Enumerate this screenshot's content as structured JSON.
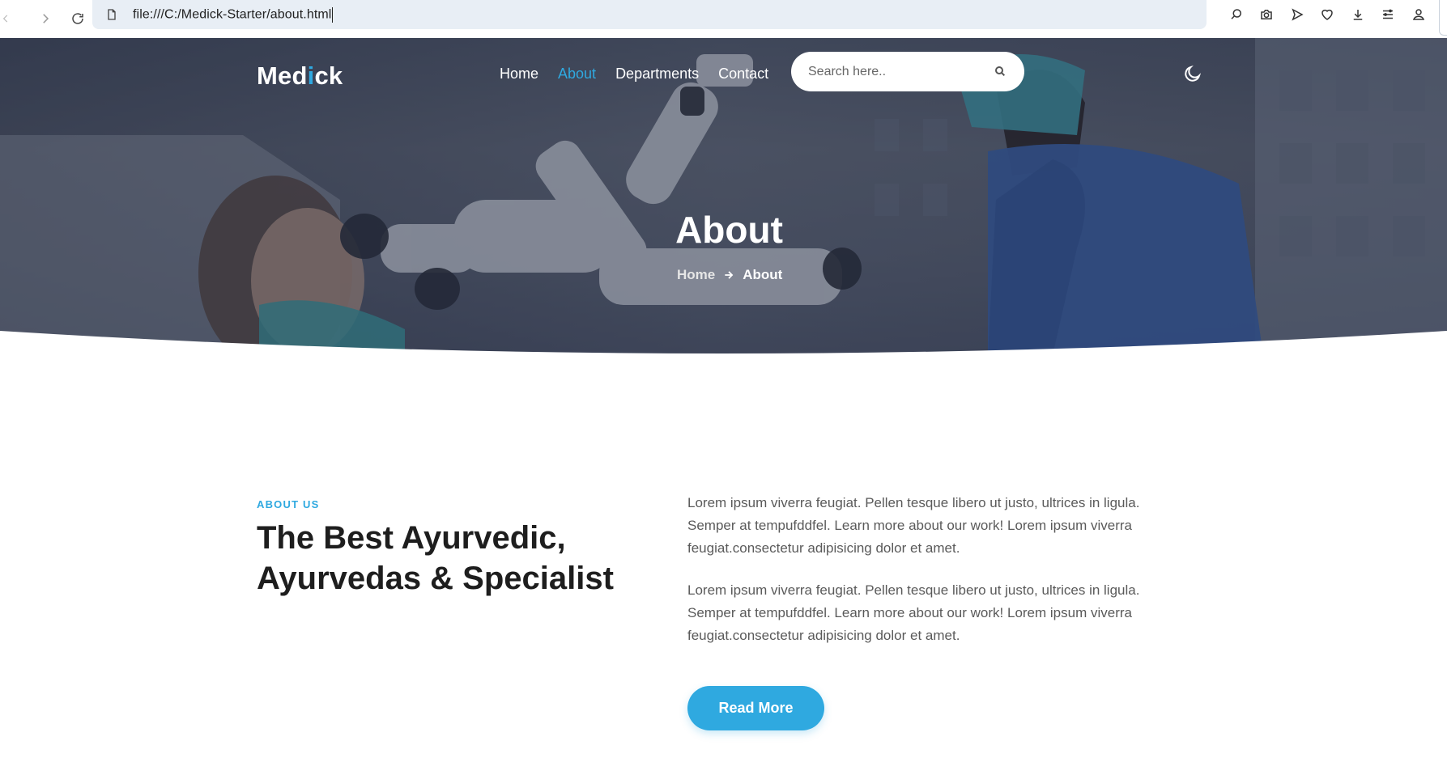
{
  "browser": {
    "url": "file:///C:/Medick-Starter/about.html",
    "toolbar_icons": [
      "search-chat-icon",
      "camera-icon",
      "send-icon",
      "heart-icon",
      "download-icon",
      "menu-icon",
      "profile-icon"
    ]
  },
  "site": {
    "logo_part1": "Med",
    "logo_accent": "i",
    "logo_part2": "ck",
    "accent_color": "#2fa9e0"
  },
  "nav": {
    "items": [
      {
        "label": "Home",
        "active": false
      },
      {
        "label": "About",
        "active": true
      },
      {
        "label": "Departments",
        "active": false
      },
      {
        "label": "Contact",
        "active": false
      }
    ]
  },
  "search": {
    "placeholder": "Search here.."
  },
  "hero": {
    "title": "About",
    "breadcrumb_home": "Home",
    "breadcrumb_current": "About"
  },
  "about": {
    "kicker": "ABOUT US",
    "heading": "The Best Ayurvedic, Ayurvedas & Specialist",
    "paragraph1": "Lorem ipsum viverra feugiat. Pellen tesque libero ut justo, ultrices in ligula. Semper at tempufddfel. Learn more about our work! Lorem ipsum viverra feugiat.consectetur adipisicing dolor et amet.",
    "paragraph2": "Lorem ipsum viverra feugiat. Pellen tesque libero ut justo, ultrices in ligula. Semper at tempufddfel. Learn more about our work! Lorem ipsum viverra feugiat.consectetur adipisicing dolor et amet.",
    "button_label": "Read More"
  }
}
